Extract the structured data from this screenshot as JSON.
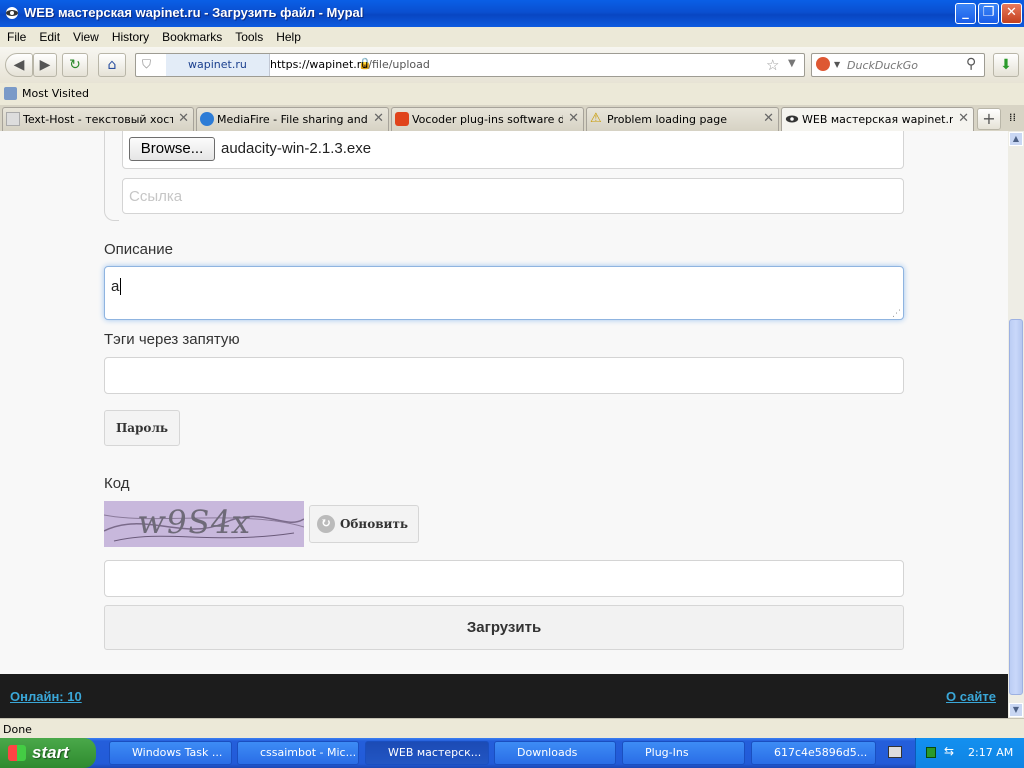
{
  "window": {
    "title": "WEB мастерская wapinet.ru - Загрузить файл - Mypal"
  },
  "menu": [
    "File",
    "Edit",
    "View",
    "History",
    "Bookmarks",
    "Tools",
    "Help"
  ],
  "nav": {
    "site_label": "wapinet.ru",
    "url_host": "https://wapinet.ru",
    "url_path": "/file/upload",
    "search_placeholder": "DuckDuckGo"
  },
  "bookmarks": {
    "most_visited": "Most Visited"
  },
  "tabs": [
    {
      "label": "Text-Host - текстовый хост..."
    },
    {
      "label": "MediaFire - File sharing and s..."
    },
    {
      "label": "Vocoder plug-ins software do..."
    },
    {
      "label": "Problem loading page"
    },
    {
      "label": "WEB мастерская wapinet.ru ..."
    }
  ],
  "form": {
    "browse_label": "Browse...",
    "file_name": "audacity-win-2.1.3.exe",
    "link_placeholder": "Ссылка",
    "description_label": "Описание",
    "description_value": "а",
    "tags_label": "Тэги через запятую",
    "tags_value": "",
    "password_button": "Пароль",
    "code_label": "Код",
    "captcha_text": "w9S4x",
    "refresh_button": "Обновить",
    "code_value": "",
    "submit_button": "Загрузить"
  },
  "footer": {
    "online": "Онлайн: 10",
    "about": "О сайте"
  },
  "status": {
    "text": "Done"
  },
  "taskbar": {
    "start": "start",
    "tasks": [
      {
        "label": "Windows Task ..."
      },
      {
        "label": "cssaimbot - Mic..."
      },
      {
        "label": "WEB мастерск..."
      },
      {
        "label": "Downloads"
      },
      {
        "label": "Plug-Ins"
      },
      {
        "label": "617c4e5896d5..."
      }
    ],
    "clock": "2:17 AM"
  }
}
